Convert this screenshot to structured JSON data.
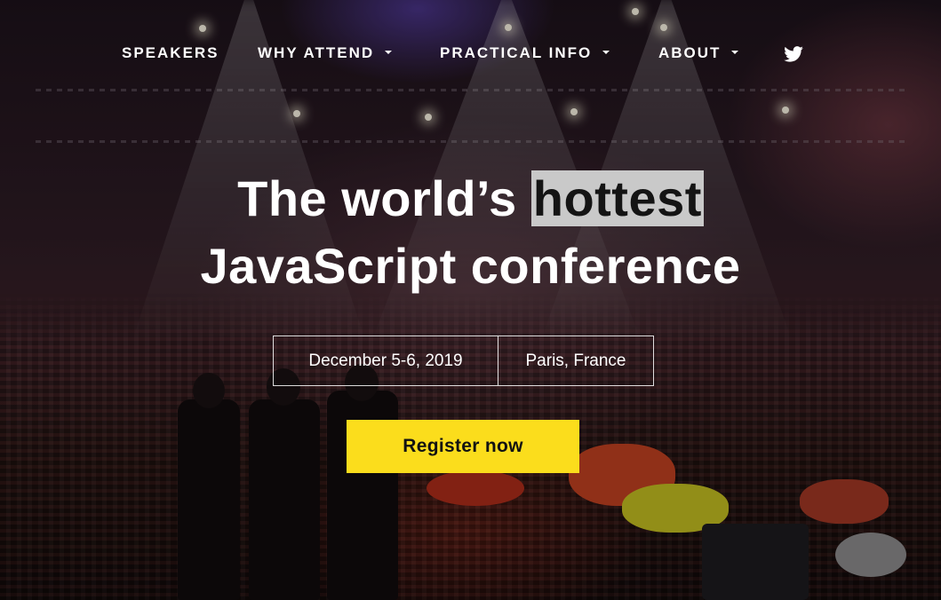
{
  "nav": {
    "items": [
      {
        "label": "SPEAKERS",
        "has_dropdown": false
      },
      {
        "label": "WHY ATTEND",
        "has_dropdown": true
      },
      {
        "label": "PRACTICAL INFO",
        "has_dropdown": true
      },
      {
        "label": "ABOUT",
        "has_dropdown": true
      }
    ],
    "social_icon": "twitter-icon"
  },
  "hero": {
    "headline_prefix": "The world’s ",
    "headline_highlight": "hottest",
    "headline_line2": "JavaScript conference",
    "date": "December 5-6, 2019",
    "location": "Paris, France",
    "cta_label": "Register now"
  },
  "colors": {
    "accent": "#fbdd1c",
    "highlight_bg": "#c9c9c9",
    "text": "#ffffff"
  }
}
